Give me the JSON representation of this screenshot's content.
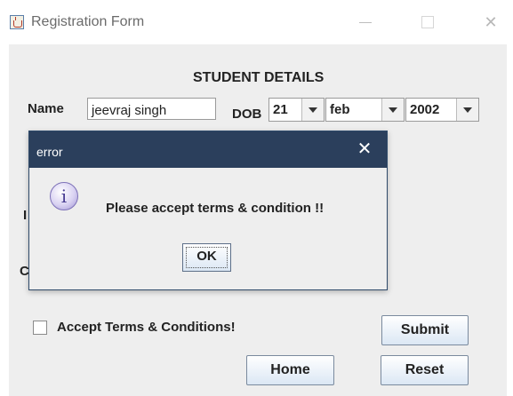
{
  "window": {
    "title": "Registration Form",
    "icon": "java-cup-icon",
    "controls": {
      "minimize": "—",
      "maximize": "☐",
      "close": "✕"
    }
  },
  "form": {
    "heading": "STUDENT DETAILS",
    "name_label": "Name",
    "name_value": "jeevraj singh",
    "dob_label": "DOB",
    "dob_day": "21",
    "dob_month": "feb",
    "dob_year": "2002",
    "partial_label_1": "I",
    "partial_label_2": "C",
    "terms_label": "Accept Terms & Conditions!",
    "terms_checked": false,
    "submit_label": "Submit",
    "home_label": "Home",
    "reset_label": "Reset"
  },
  "dialog": {
    "title": "error",
    "close_glyph": "✕",
    "icon": "info-icon",
    "icon_glyph": "i",
    "message": "Please accept terms & condition !!",
    "ok_label": "OK"
  },
  "colors": {
    "dialog_titlebar": "#2b3f5c",
    "panel_bg": "#eeeeee",
    "button_gradient_end": "#dbe7f4"
  }
}
